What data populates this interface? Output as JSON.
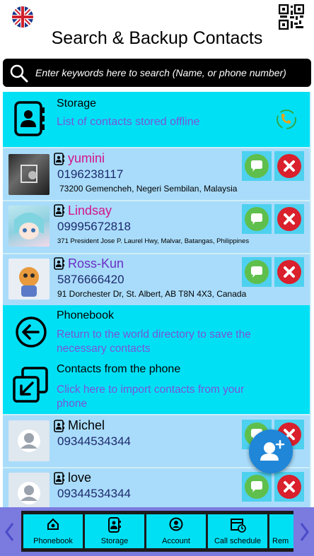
{
  "header": {
    "title": "Search & Backup Contacts"
  },
  "search": {
    "placeholder": "Enter keywords here to search (Name, or phone number)"
  },
  "storage": {
    "title": "Storage",
    "subtitle": "List of contacts stored offline"
  },
  "contacts_top": [
    {
      "name": "yumini",
      "phone": "0196238117",
      "address": "73200 Gemencheh, Negeri Sembilan, Malaysia",
      "name_color": "#d4148c"
    },
    {
      "name": "Lindsay",
      "phone": "09995672818",
      "address": "371 President Jose P. Laurel Hwy, Malvar, Batangas, Philippines",
      "name_color": "#d4148c"
    },
    {
      "name": "Ross-Kun",
      "phone": "5876666420",
      "address": "91 Dorchester Dr, St. Albert, AB T8N 4X3, Canada",
      "name_color": "#6a2fc4"
    }
  ],
  "phonebook": {
    "title": "Phonebook",
    "subtitle": "Return to the world directory to save the necessary contacts"
  },
  "import": {
    "title": "Contacts from the phone",
    "subtitle": "Click here to import contacts from your phone"
  },
  "contacts_bottom": [
    {
      "name": "Michel",
      "phone": "09344534344"
    },
    {
      "name": "love",
      "phone": "09344534344"
    }
  ],
  "bottom_nav": [
    {
      "label": "Phonebook",
      "icon": "home-icon"
    },
    {
      "label": "Storage",
      "icon": "contact-book-icon"
    },
    {
      "label": "Account",
      "icon": "account-icon"
    },
    {
      "label": "Call schedule",
      "icon": "calendar-icon"
    },
    {
      "label": "Rem",
      "icon": "reminder-icon"
    }
  ],
  "colors": {
    "accent_cyan": "#00e0f5",
    "row_blue": "#a9dcfa",
    "nav_bg": "#7a7adf",
    "fab": "#1f86d8"
  }
}
